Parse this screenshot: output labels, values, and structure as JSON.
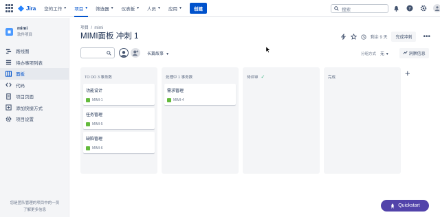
{
  "topbar": {
    "logo": "Jira",
    "nav": [
      {
        "label": "您的工作",
        "active": false
      },
      {
        "label": "项目",
        "active": true
      },
      {
        "label": "筛选器",
        "active": false
      },
      {
        "label": "仪表板",
        "active": false
      },
      {
        "label": "人员",
        "active": false
      },
      {
        "label": "应用",
        "active": false
      }
    ],
    "create": "创建",
    "search_placeholder": "搜索"
  },
  "sidebar": {
    "project_name": "mimi",
    "project_type": "软件项目",
    "items": [
      {
        "label": "路线图",
        "icon": "roadmap-icon",
        "active": false
      },
      {
        "label": "待办事项列表",
        "icon": "backlog-icon",
        "active": false
      },
      {
        "label": "面板",
        "icon": "board-icon",
        "active": true
      },
      {
        "label": "代码",
        "icon": "code-icon",
        "active": false
      },
      {
        "label": "项目页面",
        "icon": "pages-icon",
        "active": false
      },
      {
        "label": "添加快捷方式",
        "icon": "add-shortcut-icon",
        "active": false
      },
      {
        "label": "项目设置",
        "icon": "settings-icon",
        "active": false
      }
    ],
    "footer_text": "您是团队管理的项目中的一员",
    "footer_link": "了解更多信息"
  },
  "main": {
    "breadcrumb": [
      "项目",
      "mimi"
    ],
    "title": "MIMI面板 冲刺 1",
    "days_left": "剩余 9 天",
    "complete_sprint": "完成冲刺",
    "epic_filter": "长篇故事",
    "group_label": "分组方式",
    "group_value": "无",
    "insights": "洞察信息",
    "columns": [
      {
        "title": "TO DO 3 事务数",
        "check": false,
        "cards": [
          {
            "title": "功能设计",
            "key": "MIMI-1"
          },
          {
            "title": "任务管理",
            "key": "MIMI-5"
          },
          {
            "title": "缺陷管理",
            "key": "MIMI-6"
          }
        ]
      },
      {
        "title": "处理中 1 事务数",
        "check": false,
        "cards": [
          {
            "title": "需求管理",
            "key": "MIMI-4"
          }
        ]
      },
      {
        "title": "待评审",
        "check": true,
        "cards": []
      },
      {
        "title": "完成",
        "check": false,
        "cards": []
      }
    ]
  },
  "quickstart": "Quickstart"
}
